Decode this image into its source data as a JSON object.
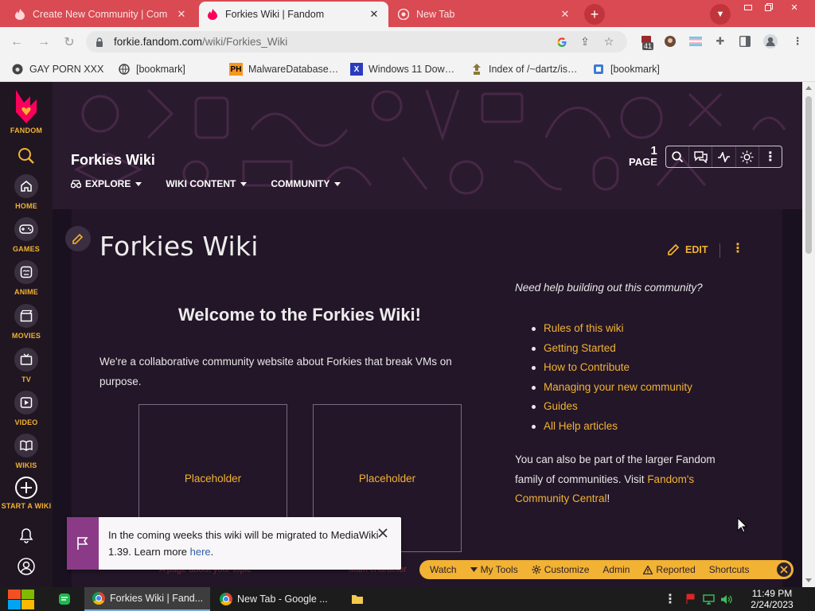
{
  "browser": {
    "tabs": [
      {
        "title": "Create New Community | Com",
        "active": false
      },
      {
        "title": "Forkies Wiki | Fandom",
        "active": true
      },
      {
        "title": "New Tab",
        "active": false
      }
    ],
    "url_host": "forkie.fandom.com",
    "url_path": "/wiki/Forkies_Wiki",
    "extension_badge": "41",
    "bookmarks": [
      {
        "label": "GAY PORN XXX"
      },
      {
        "label": "[bookmark]"
      },
      {
        "label": "MalwareDatabase…",
        "icon": "PH"
      },
      {
        "label": "Windows 11 Dow…",
        "icon": "X"
      },
      {
        "label": "Index of /~dartz/is…"
      },
      {
        "label": "[bookmark]"
      }
    ]
  },
  "rail": {
    "brand": "FANDOM",
    "items": [
      {
        "label": "HOME",
        "icon": "home-icon"
      },
      {
        "label": "GAMES",
        "icon": "gamepad-icon"
      },
      {
        "label": "ANIME",
        "icon": "anime-face-icon"
      },
      {
        "label": "MOVIES",
        "icon": "clapper-icon"
      },
      {
        "label": "TV",
        "icon": "tv-icon"
      },
      {
        "label": "VIDEO",
        "icon": "play-icon"
      },
      {
        "label": "WIKIS",
        "icon": "book-icon"
      },
      {
        "label": "START A WIKI",
        "icon": "plus-circle-icon"
      }
    ]
  },
  "header": {
    "wiki_name": "Forkies Wiki",
    "nav": [
      {
        "label": "EXPLORE"
      },
      {
        "label": "WIKI CONTENT"
      },
      {
        "label": "COMMUNITY"
      }
    ],
    "page_count": "1",
    "page_word": "PAGE"
  },
  "article": {
    "title": "Forkies Wiki",
    "edit_label": "EDIT",
    "welcome": "Welcome to the Forkies Wiki!",
    "intro": "We're a collaborative community website about Forkies that break VMs on purpose.",
    "placeholders": [
      "Placeholder",
      "Placeholder"
    ],
    "faded_captions": [
      "A page about your topic",
      "Main character"
    ]
  },
  "help": {
    "question": "Need help building out this community?",
    "links": [
      "Rules of this wiki",
      "Getting Started",
      "How to Contribute",
      "Managing your new community",
      "Guides",
      "All Help articles"
    ],
    "family_text": "You can also be part of the larger Fandom family of communities. Visit ",
    "family_link": "Fandom's Community Central",
    "family_end": "!"
  },
  "notice": {
    "text": "In the coming weeks this wiki will be migrated to MediaWiki 1.39. Learn more ",
    "link": "here",
    "end": "."
  },
  "bottom_toolbar": {
    "items": [
      "Watch",
      "My Tools",
      "Customize",
      "Admin",
      "Reported",
      "Shortcuts"
    ]
  },
  "taskbar": {
    "windows": [
      "Forkies Wiki | Fand...",
      "New Tab - Google ..."
    ],
    "time": "11:49 PM",
    "date": "2/24/2023"
  },
  "colors": {
    "accent": "#f2b233",
    "tabstrip": "#d94a52",
    "page_bg": "#1a1120",
    "card_bg": "#231628"
  }
}
